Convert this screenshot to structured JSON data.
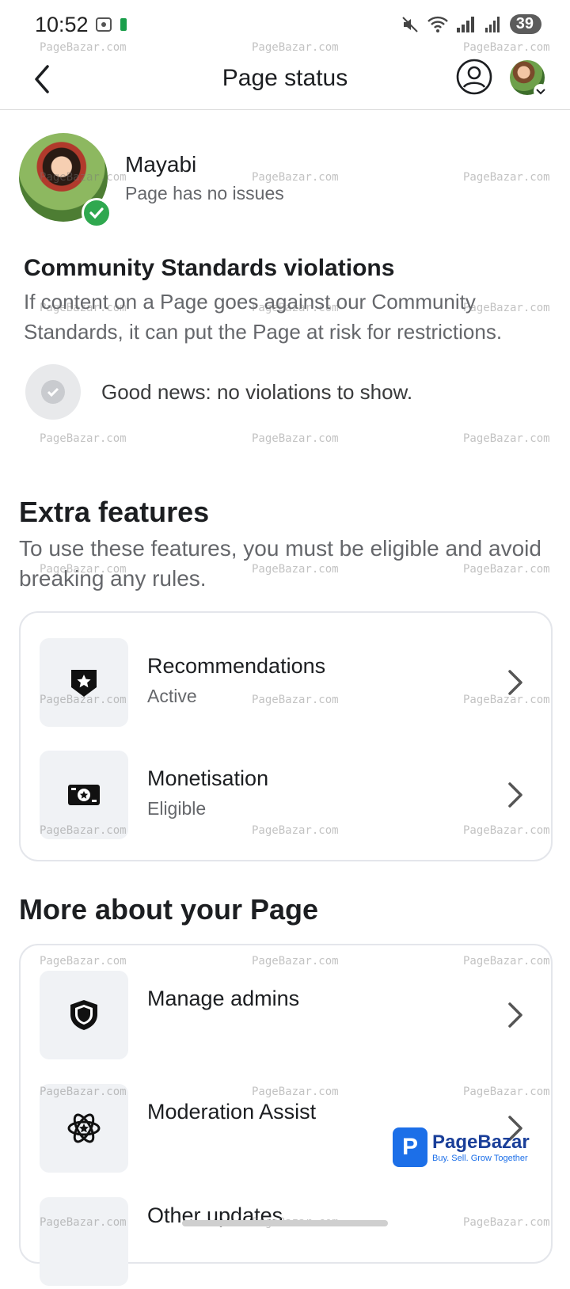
{
  "status_bar": {
    "time": "10:52",
    "battery": "39"
  },
  "header": {
    "title": "Page status"
  },
  "page": {
    "name": "Mayabi",
    "status": "Page has no issues"
  },
  "community": {
    "heading": "Community Standards violations",
    "description": "If content on a Page goes against our Community Standards, it can put the Page at risk for restrictions.",
    "good_news": "Good news: no violations to show."
  },
  "extra_features": {
    "heading": "Extra features",
    "description": "To use these features, you must be eligible and avoid breaking any rules.",
    "items": [
      {
        "label": "Recommendations",
        "status": "Active",
        "icon": "badge-star-icon"
      },
      {
        "label": "Monetisation",
        "status": "Eligible",
        "icon": "money-icon"
      }
    ]
  },
  "more_about": {
    "heading": "More about your Page",
    "items": [
      {
        "label": "Manage admins",
        "icon": "shield-icon"
      },
      {
        "label": "Moderation Assist",
        "icon": "atom-star-icon"
      },
      {
        "label": "Other updates",
        "icon": "updates-icon"
      }
    ]
  },
  "watermark": {
    "text": "PageBazar.com",
    "brand": "PageBazar",
    "tagline": "Buy. Sell. Grow Together"
  },
  "colors": {
    "primary_text": "#1c1e21",
    "secondary_text": "#65676b",
    "verified": "#2fa84f",
    "brand_blue": "#1c6fe8"
  }
}
